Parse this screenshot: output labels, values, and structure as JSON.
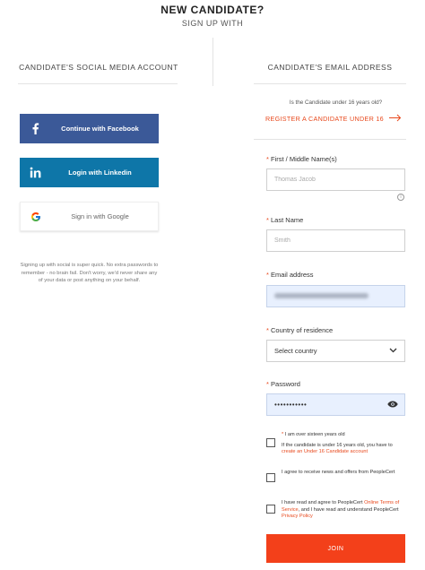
{
  "header": {
    "title": "NEW CANDIDATE?",
    "subtitle": "SIGN UP WITH"
  },
  "social": {
    "heading": "CANDIDATE'S SOCIAL MEDIA ACCOUNT",
    "facebook_label": "Continue with Facebook",
    "linkedin_label": "Login with Linkedin",
    "google_label": "Sign in with Google",
    "note": "Signing up with social is super quick. No extra passwords to remember - no brain fail. Don't worry, we'd never share any of your data or post anything on your behalf."
  },
  "email_signup": {
    "heading": "CANDIDATE'S EMAIL ADDRESS",
    "under16_question": "Is the Candidate under 16 years old?",
    "under16_link": "REGISTER A CANDIDATE UNDER 16"
  },
  "form": {
    "first_name": {
      "required_mark": "*",
      "label": "First / Middle Name(s)",
      "placeholder": "Thomas Jacob",
      "info": "i"
    },
    "last_name": {
      "required_mark": "*",
      "label": "Last Name",
      "placeholder": "Smith"
    },
    "email": {
      "required_mark": "*",
      "label": "Email address"
    },
    "country": {
      "required_mark": "*",
      "label": "Country of residence",
      "selected": "Select country"
    },
    "password": {
      "required_mark": "*",
      "label": "Password",
      "value": "•••••••••••"
    },
    "checkboxes": {
      "age": {
        "required_mark": "*",
        "line1": "I am over sixteen years old",
        "line2": "If the candidate is under 16 years old, you have to",
        "link": "create an Under 16 Candidate account"
      },
      "news": {
        "text": "I agree to receive news and offers from PeopleCert"
      },
      "terms": {
        "text_before": "I have read and agree to PeopleCert ",
        "terms_link": "Online Terms of Service",
        "text_middle": ", and I have read and understand PeopleCert ",
        "privacy_link": "Privacy Policy"
      }
    },
    "join_label": "JOIN"
  },
  "colors": {
    "accent": "#e8491d",
    "join_button": "#f3401a",
    "facebook": "#3b5998",
    "linkedin": "#0e76a8"
  }
}
